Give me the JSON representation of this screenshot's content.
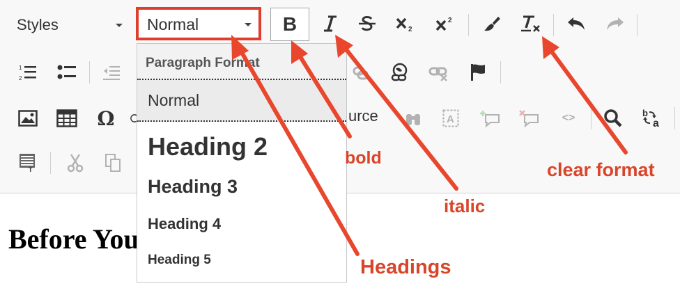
{
  "toolbar": {
    "styles_label": "Styles",
    "format_value": "Normal",
    "bold_label": "B",
    "source_label": "urce"
  },
  "format_dropdown": {
    "title": "Paragraph Format",
    "items": [
      "Normal",
      "Heading 2",
      "Heading 3",
      "Heading 4",
      "Heading 5"
    ],
    "selected": "Normal"
  },
  "editor": {
    "heading": "Before You"
  },
  "annotations": {
    "bold": "bold",
    "italic": "italic",
    "clear_format": "clear format",
    "headings": "Headings",
    "color": "#d9452a",
    "highlight_color": "#e03e2d"
  },
  "icons": [
    "italic-icon",
    "strikethrough-icon",
    "subscript-icon",
    "superscript-icon",
    "copy-format-icon",
    "remove-format-icon",
    "undo-icon",
    "redo-icon",
    "numbered-list-icon",
    "bulleted-list-icon",
    "outdent-icon",
    "link-icon",
    "unlink-icon",
    "anchor-icon",
    "image-icon",
    "table-icon",
    "special-char-icon",
    "find-icon",
    "replace-icon",
    "paste-text-icon",
    "cut-icon",
    "copy-icon"
  ]
}
